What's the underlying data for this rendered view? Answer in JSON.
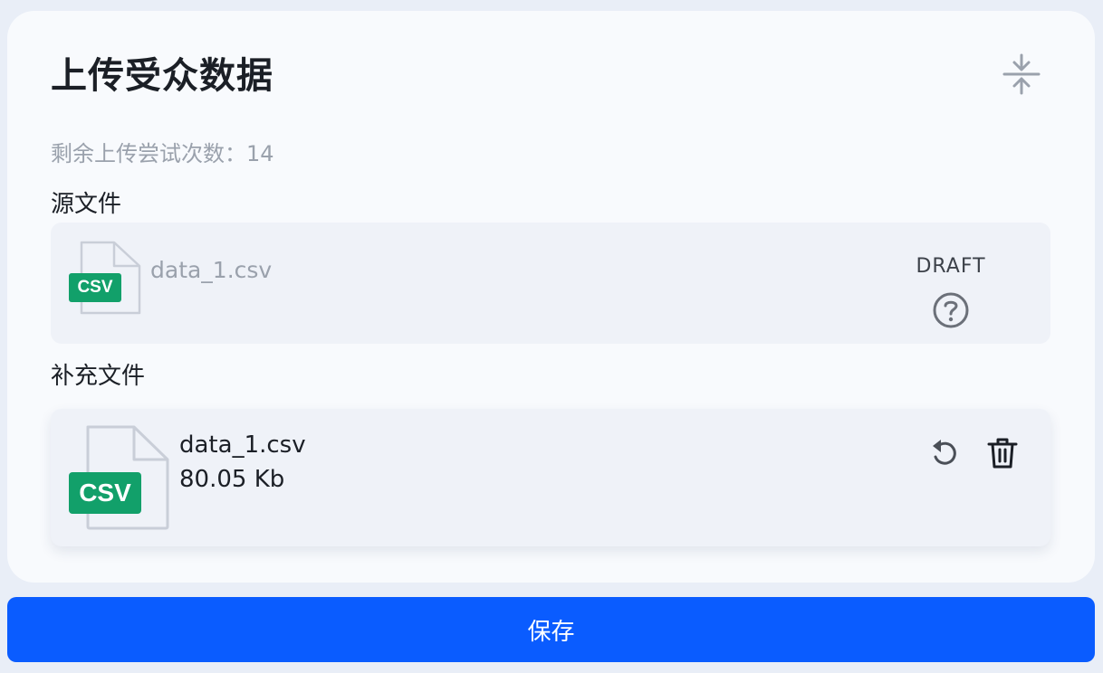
{
  "header": {
    "title": "上传受众数据",
    "collapse_icon": "collapse-vertical-icon"
  },
  "attempts": {
    "text": "剩余上传尝试次数：14"
  },
  "source_file": {
    "section_label": "源文件",
    "file_type_badge": "CSV",
    "file_name": "data_1.csv",
    "status": "DRAFT",
    "status_icon": "question-circle-icon"
  },
  "supplementary_file": {
    "section_label": "补充文件",
    "file_type_badge": "CSV",
    "file_name": "data_1.csv",
    "file_size": "80.05 Kb",
    "actions": [
      "undo-icon",
      "trash-icon"
    ]
  },
  "footer": {
    "save_label": "保存"
  },
  "colors": {
    "primary": "#0a5cff",
    "csv_badge": "#12a06a",
    "card_bg": "#f8fafd",
    "file_box_bg": "#eff2f8",
    "muted_text": "#9aa1ac"
  }
}
